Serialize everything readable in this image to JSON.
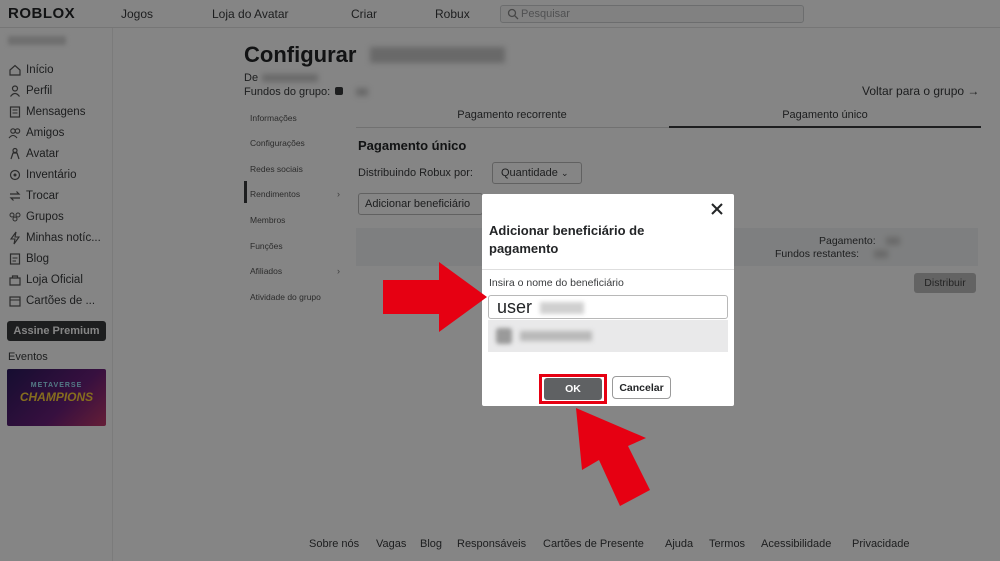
{
  "nav": {
    "logo": "ROBLOX",
    "links": [
      "Jogos",
      "Loja do Avatar",
      "Criar",
      "Robux"
    ],
    "search_placeholder": "Pesquisar"
  },
  "sidebar": {
    "items": [
      {
        "label": "Início",
        "icon": "home-icon"
      },
      {
        "label": "Perfil",
        "icon": "profile-icon"
      },
      {
        "label": "Mensagens",
        "icon": "messages-icon"
      },
      {
        "label": "Amigos",
        "icon": "friends-icon"
      },
      {
        "label": "Avatar",
        "icon": "avatar-icon"
      },
      {
        "label": "Inventário",
        "icon": "inventory-icon"
      },
      {
        "label": "Trocar",
        "icon": "trade-icon"
      },
      {
        "label": "Grupos",
        "icon": "groups-icon"
      },
      {
        "label": "Minhas notíc...",
        "icon": "news-icon"
      },
      {
        "label": "Blog",
        "icon": "blog-icon"
      },
      {
        "label": "Loja Oficial",
        "icon": "shop-icon"
      },
      {
        "label": "Cartões de ...",
        "icon": "gift-card-icon"
      }
    ],
    "premium_label": "Assine Premium",
    "events_label": "Eventos",
    "event_banner": {
      "line1": "METAVERSE",
      "line2": "CHAMPIONS"
    }
  },
  "main": {
    "title": "Configurar",
    "by_label": "De",
    "funds_label": "Fundos do grupo:",
    "back_link": "Voltar para o grupo →",
    "left_menu": [
      "Informações",
      "Configurações",
      "Redes sociais",
      "Rendimentos",
      "Membros",
      "Funções",
      "Afiliados",
      "Atividade do grupo"
    ],
    "tabs": [
      "Pagamento recorrente",
      "Pagamento único"
    ],
    "section_title": "Pagamento único",
    "distribute_label": "Distribuindo Robux por:",
    "distribute_select": "Quantidade",
    "add_button": "Adicionar beneficiário",
    "payment_label": "Pagamento:",
    "remaining_label": "Fundos restantes:",
    "distribute_button": "Distribuir"
  },
  "modal": {
    "title": "Adicionar beneficiário de pagamento",
    "field_label": "Insira o nome do beneficiário",
    "input_value": "user",
    "ok_label": "OK",
    "cancel_label": "Cancelar"
  },
  "footer": [
    "Sobre nós",
    "Vagas",
    "Blog",
    "Responsáveis",
    "Cartões de Presente",
    "Ajuda",
    "Termos",
    "Acessibilidade",
    "Privacidade"
  ],
  "colors": {
    "highlight": "#e60012",
    "overlay": "rgba(0,0,0,0.48)",
    "ok_button": "#5f6163"
  }
}
